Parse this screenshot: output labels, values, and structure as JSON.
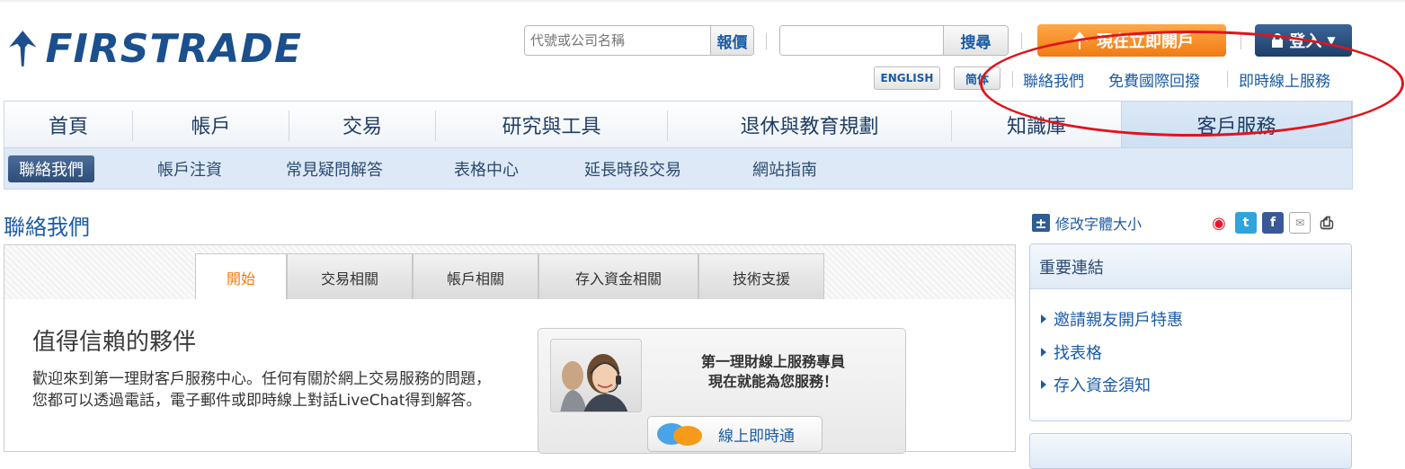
{
  "brand": {
    "name": "FIRSTRADE",
    "color": "#1b4f8d"
  },
  "header": {
    "quote_placeholder": "代號或公司名稱",
    "quote_button": "報價",
    "search_button": "搜尋",
    "open_account": "現在立即開戶",
    "login": "登入",
    "lang_english": "ENGLISH",
    "lang_simplified": "简体",
    "links": [
      "聯絡我們",
      "免費國際回撥",
      "即時線上服務"
    ]
  },
  "nav": {
    "items": [
      "首頁",
      "帳戶",
      "交易",
      "研究與工具",
      "退休與教育規劃",
      "知識庫",
      "客戶服務"
    ],
    "active": "客戶服務"
  },
  "subnav": {
    "items": [
      "聯絡我們",
      "帳戶注資",
      "常見疑問解答",
      "表格中心",
      "延長時段交易",
      "網站指南"
    ]
  },
  "page": {
    "title": "聯絡我們"
  },
  "tabs": {
    "items": [
      "開始",
      "交易相關",
      "帳戶相關",
      "存入資金相關",
      "技術支援"
    ],
    "active": "開始"
  },
  "content": {
    "heading": "值得信賴的夥伴",
    "welcome": "歡迎來到第一理財客戶服務中心。任何有關於網上交易服務的問題，您都可以透過電話，電子郵件或即時線上對話LiveChat得到解答。",
    "support_line1": "第一理財線上服務專員",
    "support_line2": "現在就能為您服務！",
    "chat_button": "線上即時通"
  },
  "sidebar": {
    "font_size": "修改字體大小",
    "links_title": "重要連結",
    "links": [
      "邀請親友開戶特惠",
      "找表格",
      "存入資金須知"
    ]
  },
  "colors": {
    "accent": "#1b5ba6",
    "orange": "#f07b12",
    "highlight": "#e0141b"
  }
}
